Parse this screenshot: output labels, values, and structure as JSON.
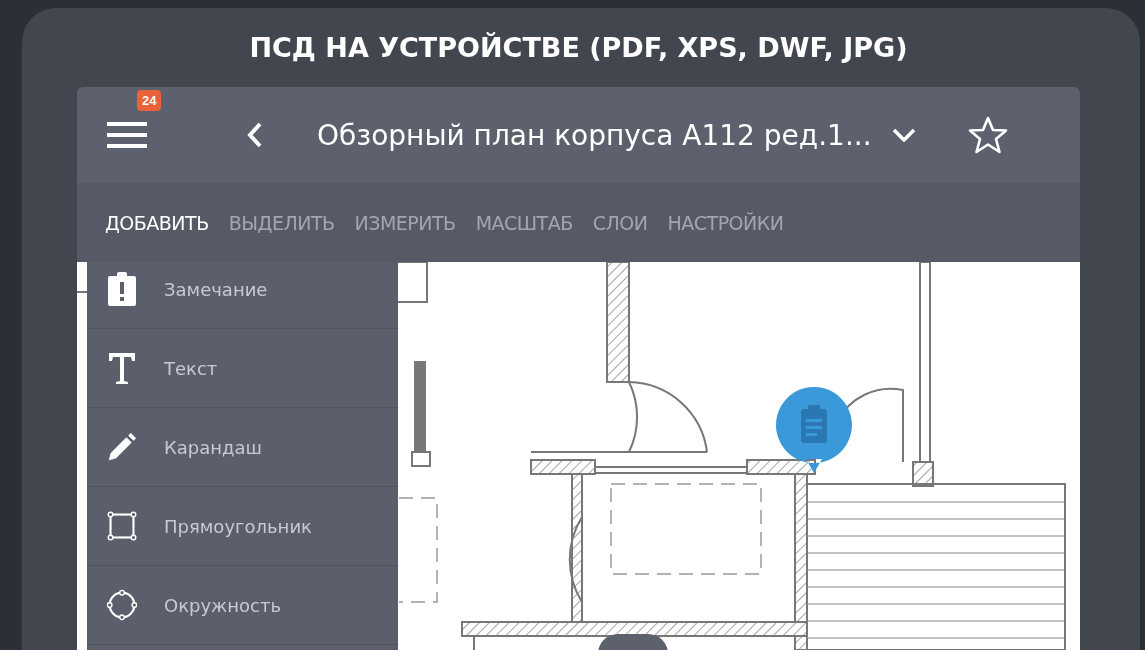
{
  "banner": {
    "title": "ПСД НА УСТРОЙСТВЕ (PDF, XPS, DWF, JPG)"
  },
  "header": {
    "badge": "24",
    "document_title": "Обзорный план корпуса А112 ред.1...",
    "favorite": false
  },
  "tabs": [
    {
      "label": "ДОБАВИТЬ",
      "selected": true
    },
    {
      "label": "ВЫДЕЛИТЬ",
      "selected": false
    },
    {
      "label": "ИЗМЕРИТЬ",
      "selected": false
    },
    {
      "label": "МАСШТАБ",
      "selected": false
    },
    {
      "label": "СЛОИ",
      "selected": false
    },
    {
      "label": "НАСТРОЙКИ",
      "selected": false
    }
  ],
  "add_menu": {
    "items": [
      {
        "label": "Замечание",
        "kind": "note"
      },
      {
        "label": "Текст",
        "kind": "text"
      },
      {
        "label": "Карандаш",
        "kind": "pencil"
      },
      {
        "label": "Прямоугольник",
        "kind": "rectangle"
      },
      {
        "label": "Окружность",
        "kind": "circle"
      }
    ]
  }
}
